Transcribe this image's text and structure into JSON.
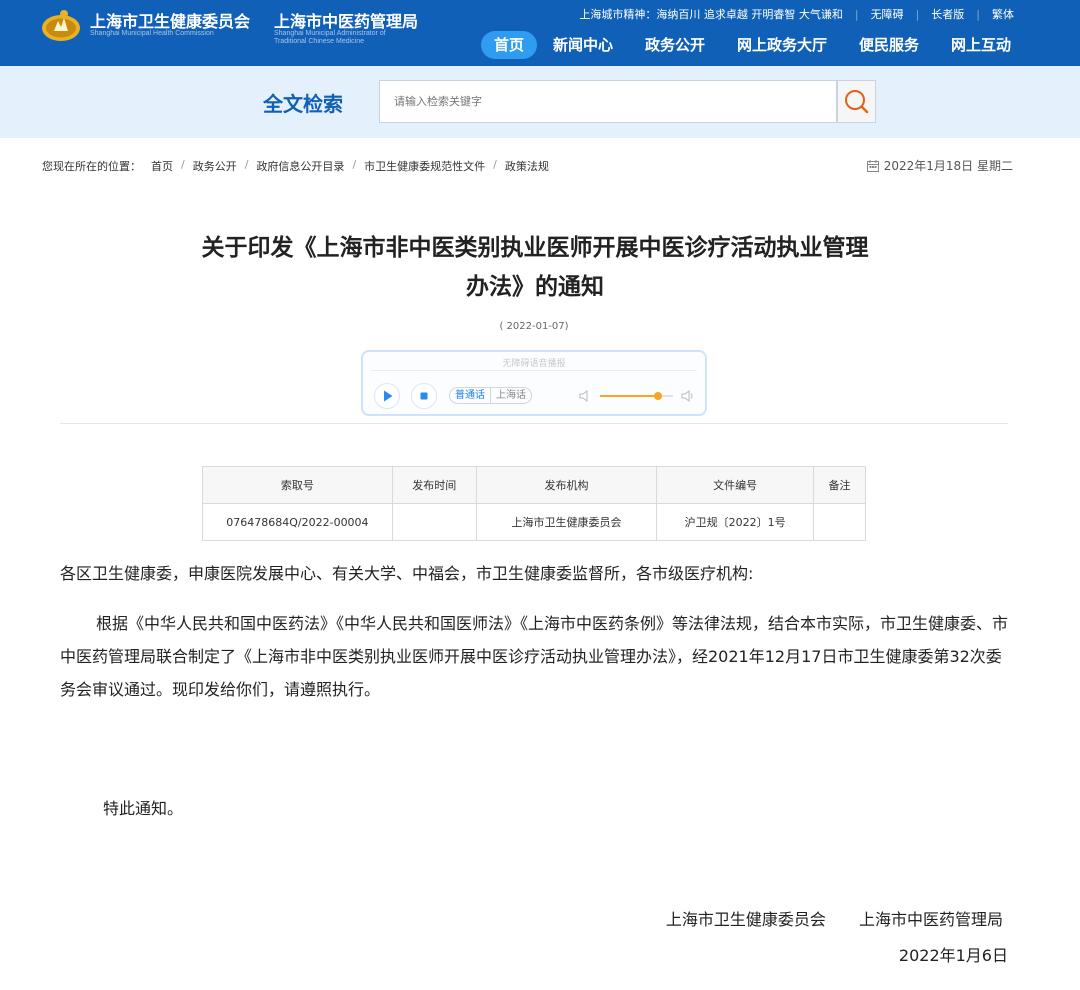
{
  "header": {
    "org1_cn": "上海市卫生健康委员会",
    "org1_en": "Shanghai Municipal Health Commission",
    "org2_cn": "上海市中医药管理局",
    "org2_en_line1": "Shanghai Municipal Administrator of",
    "org2_en_line2": "Traditional Chinese Medicine",
    "city_spirit": "上海城市精神：海纳百川 追求卓越 开明睿智 大气谦和",
    "links": [
      "无障碍",
      "长者版",
      "繁体"
    ],
    "nav": [
      "首页",
      "新闻中心",
      "政务公开",
      "网上政务大厅",
      "便民服务",
      "网上互动"
    ],
    "nav_active": "首页",
    "colors": {
      "brand": "#1160b7",
      "active_tab": "#2f9cf2"
    }
  },
  "search": {
    "label": "全文检索",
    "placeholder": "请输入检索关键字",
    "button_icon": "search-icon"
  },
  "breadcrumb": {
    "prefix": "您现在所在的位置：",
    "items": [
      "首页",
      "政务公开",
      "政府信息公开目录",
      "市卫生健康委规范性文件",
      "政策法规"
    ]
  },
  "today": "2022年1月18日 星期二",
  "article": {
    "title_line1": "关于印发《上海市非中医类别执业医师开展中医诊疗活动执业管理",
    "title_line2": "办法》的通知",
    "pub_date": "( 2022-01-07)"
  },
  "player": {
    "title": "无障碍语音播报",
    "lang_options": [
      "普通话",
      "上海话"
    ],
    "lang_selected": "普通话",
    "volume_level": 0.8
  },
  "info_table": {
    "headers": [
      "索取号",
      "发布时间",
      "发布机构",
      "文件编号",
      "备注"
    ],
    "row": [
      "076478684Q/2022-00004",
      "",
      "上海市卫生健康委员会",
      "沪卫规〔2022〕1号",
      ""
    ]
  },
  "body": {
    "addressees": "各区卫生健康委，申康医院发展中心、有关大学、中福会，市卫生健康委监督所，各市级医疗机构:",
    "main": "根据《中华人民共和国中医药法》《中华人民共和国医师法》《上海市中医药条例》等法律法规，结合本市实际，市卫生健康委、市中医药管理局联合制定了《上海市非中医类别执业医师开展中医诊疗活动执业管理办法》，经2021年12月17日市卫生健康委第32次委务会审议通过。现印发给你们，请遵照执行。",
    "notice": "特此通知。",
    "signers": [
      "上海市卫生健康委员会",
      "上海市中医药管理局"
    ],
    "sign_date": "2022年1月6日"
  }
}
